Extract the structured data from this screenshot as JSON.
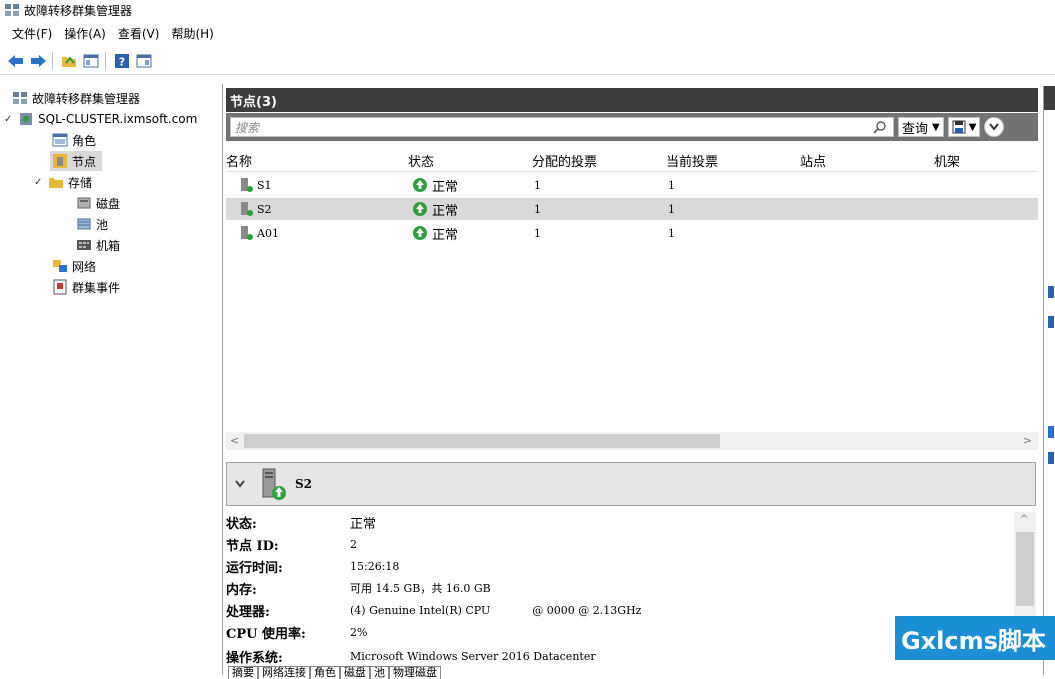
{
  "window": {
    "title": "故障转移群集管理器"
  },
  "menu": [
    "文件(F)",
    "操作(A)",
    "查看(V)",
    "帮助(H)"
  ],
  "tree": {
    "root": "故障转移群集管理器",
    "cluster": "SQL-CLUSTER.ixmsoft.com",
    "roles": "角色",
    "nodes": "节点",
    "storage": "存储",
    "disks": "磁盘",
    "pools": "池",
    "enclosures": "机箱",
    "networks": "网络",
    "events": "群集事件"
  },
  "center": {
    "title": "节点(3)",
    "search_placeholder": "搜索",
    "query_label": "查询"
  },
  "table": {
    "headers": [
      "名称",
      "状态",
      "分配的投票",
      "当前投票",
      "站点",
      "机架"
    ],
    "rows": [
      {
        "name": "S1",
        "status": "正常",
        "assigned": "1",
        "current": "1"
      },
      {
        "name": "S2",
        "status": "正常",
        "assigned": "1",
        "current": "1"
      },
      {
        "name": "A01",
        "status": "正常",
        "assigned": "1",
        "current": "1"
      }
    ]
  },
  "detail": {
    "node_name": "S2",
    "fields": [
      {
        "label": "状态:",
        "value": "正常"
      },
      {
        "label": "节点 ID:",
        "value": "2"
      },
      {
        "label": "运行时间:",
        "value": "15:26:18"
      },
      {
        "label": "内存:",
        "value": "可用 14.5 GB，共 16.0 GB"
      },
      {
        "label": "处理器:",
        "value": "(4) Genuine Intel(R) CPU            @ 0000 @ 2.13GHz"
      },
      {
        "label": "CPU 使用率:",
        "value": "2%"
      },
      {
        "label": "操作系统:",
        "value": "Microsoft Windows Server 2016 Datacenter"
      }
    ],
    "tabs": [
      "摘要",
      "网络连接",
      "角色",
      "磁盘",
      "池",
      "物理磁盘"
    ]
  },
  "watermark": "Gxlcms脚本",
  "colors": {
    "header_dark": "#3d3d3d",
    "search_bar": "#737373",
    "selected_row": "#d9d9d9",
    "status_green": "#2e9e3e",
    "watermark": "#1a8fd6"
  }
}
